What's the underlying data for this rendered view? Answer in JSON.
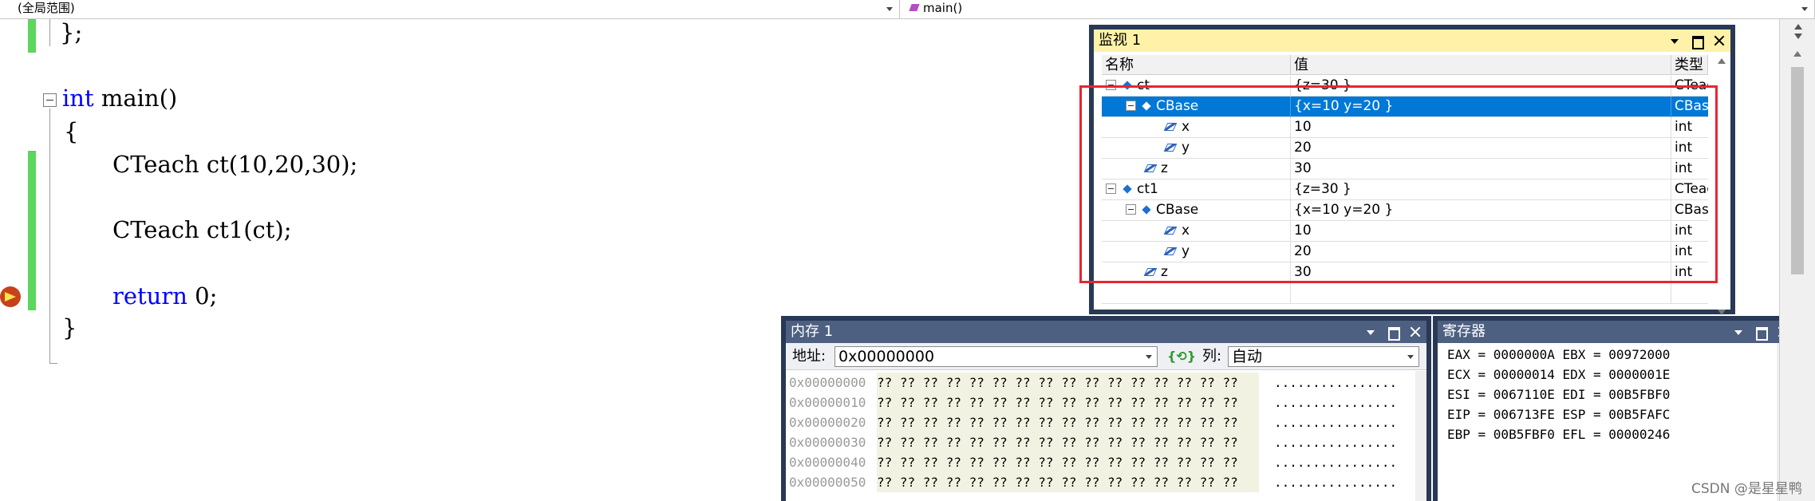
{
  "navbar": {
    "scope": "(全局范围)",
    "function": "main()"
  },
  "code": {
    "lines": [
      "};",
      "int",
      " main()",
      "{",
      "CTeach ct(10,20,30);",
      "CTeach ct1(ct);",
      "return",
      " 0;",
      "}"
    ]
  },
  "watch": {
    "title": "监视 1",
    "col_name": "名称",
    "col_value": "值",
    "col_type": "类型",
    "rows": [
      {
        "name": "ct",
        "value": "{z=30 }",
        "type": "CTeac"
      },
      {
        "name": "CBase",
        "value": "{x=10 y=20 }",
        "type": "CBase"
      },
      {
        "name": "x",
        "value": "10",
        "type": "int"
      },
      {
        "name": "y",
        "value": "20",
        "type": "int"
      },
      {
        "name": "z",
        "value": "30",
        "type": "int"
      },
      {
        "name": "ct1",
        "value": "{z=30 }",
        "type": "CTeac"
      },
      {
        "name": "CBase",
        "value": "{x=10 y=20 }",
        "type": "CBase"
      },
      {
        "name": "x",
        "value": "10",
        "type": "int"
      },
      {
        "name": "y",
        "value": "20",
        "type": "int"
      },
      {
        "name": "z",
        "value": "30",
        "type": "int"
      }
    ]
  },
  "memory": {
    "title": "内存 1",
    "addr_label": "地址:",
    "addr_value": "0x00000000",
    "col_label": "列:",
    "col_value": "自动",
    "rows": [
      {
        "addr": "0x00000000",
        "bytes": "?? ?? ?? ?? ?? ?? ?? ?? ?? ?? ?? ?? ?? ?? ?? ??",
        "ascii": "................"
      },
      {
        "addr": "0x00000010",
        "bytes": "?? ?? ?? ?? ?? ?? ?? ?? ?? ?? ?? ?? ?? ?? ?? ??",
        "ascii": "................"
      },
      {
        "addr": "0x00000020",
        "bytes": "?? ?? ?? ?? ?? ?? ?? ?? ?? ?? ?? ?? ?? ?? ?? ??",
        "ascii": "................"
      },
      {
        "addr": "0x00000030",
        "bytes": "?? ?? ?? ?? ?? ?? ?? ?? ?? ?? ?? ?? ?? ?? ?? ??",
        "ascii": "................"
      },
      {
        "addr": "0x00000040",
        "bytes": "?? ?? ?? ?? ?? ?? ?? ?? ?? ?? ?? ?? ?? ?? ?? ??",
        "ascii": "................"
      },
      {
        "addr": "0x00000050",
        "bytes": "?? ?? ?? ?? ?? ?? ?? ?? ?? ?? ?? ?? ?? ?? ?? ??",
        "ascii": "................"
      }
    ]
  },
  "registers": {
    "title": "寄存器",
    "lines": [
      "EAX = 0000000A EBX = 00972000",
      "ECX = 00000014 EDX = 0000001E",
      "ESI = 0067110E EDI = 00B5FBF0",
      "EIP = 006713FE ESP = 00B5FAFC",
      "EBP = 00B5FBF0 EFL = 00000246"
    ]
  },
  "watermark": "CSDN @是星星鸭",
  "icons": {
    "breakpoint": "current-statement-arrow-icon",
    "function": "function-icon",
    "object": "object-icon",
    "field": "field-icon",
    "refresh": "refresh-icon"
  },
  "colors": {
    "selection": "#0078d7",
    "active_title": "#fff2a8",
    "tool_frame": "#293955",
    "highlight_box": "#e8252f",
    "keyword": "#0000ff",
    "change_bar": "#5cd65c"
  }
}
